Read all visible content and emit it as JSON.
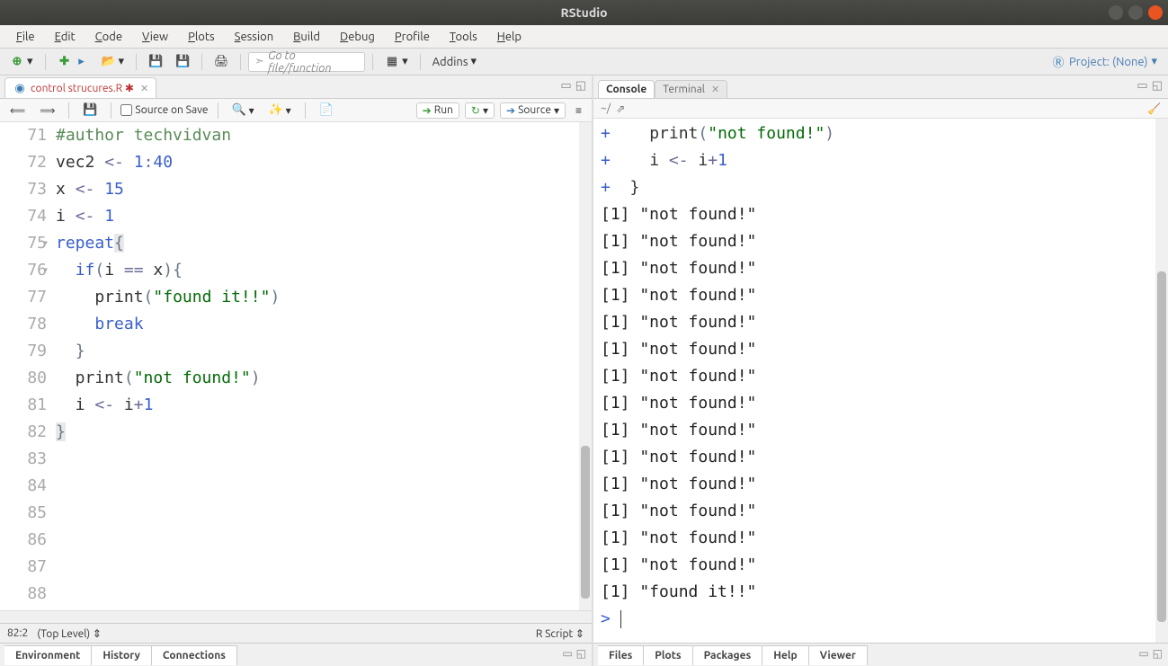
{
  "window": {
    "title": "RStudio"
  },
  "menus": [
    "File",
    "Edit",
    "Code",
    "View",
    "Plots",
    "Session",
    "Build",
    "Debug",
    "Profile",
    "Tools",
    "Help"
  ],
  "toolbar": {
    "goto_placeholder": "Go to file/function",
    "addins": "Addins",
    "project": "Project: (None)"
  },
  "source": {
    "tab_label": "control strucures.R",
    "save_on_source": "Source on Save",
    "run": "Run",
    "source_btn": "Source",
    "cursor_pos": "82:2",
    "scope": "(Top Level)",
    "lang": "R Script",
    "lines": [
      {
        "n": 71,
        "html": "<span class='tk-comment'>#author techvidvan</span>"
      },
      {
        "n": 72,
        "html": "vec2 <span class='tk-op'>&lt;-</span> <span class='tk-num'>1</span><span class='tk-op'>:</span><span class='tk-num'>40</span>"
      },
      {
        "n": 73,
        "html": "x <span class='tk-op'>&lt;-</span> <span class='tk-num'>15</span>"
      },
      {
        "n": 74,
        "html": "i <span class='tk-op'>&lt;-</span> <span class='tk-num'>1</span>"
      },
      {
        "n": 75,
        "fold": true,
        "html": "<span class='tk-kw'>repeat</span><span class='tk-paren' style='background:#e8e8e8'>{</span>"
      },
      {
        "n": 76,
        "fold": true,
        "html": "  <span class='tk-kw'>if</span><span class='tk-paren'>(</span>i <span class='tk-op'>==</span> x<span class='tk-paren'>){</span>"
      },
      {
        "n": 77,
        "html": "    print<span class='tk-paren'>(</span><span class='tk-str'>\"found it!!\"</span><span class='tk-paren'>)</span>"
      },
      {
        "n": 78,
        "html": "    <span class='tk-kw'>break</span>"
      },
      {
        "n": 79,
        "html": "  <span class='tk-paren'>}</span>"
      },
      {
        "n": 80,
        "html": "  print<span class='tk-paren'>(</span><span class='tk-str'>\"not found!\"</span><span class='tk-paren'>)</span>"
      },
      {
        "n": 81,
        "html": "  i <span class='tk-op'>&lt;-</span> i<span class='tk-op'>+</span><span class='tk-num'>1</span>"
      },
      {
        "n": 82,
        "html": "<span class='tk-paren' style='background:#e8e8e8'>}</span>"
      },
      {
        "n": 83,
        "html": ""
      },
      {
        "n": 84,
        "html": ""
      },
      {
        "n": 85,
        "html": ""
      },
      {
        "n": 86,
        "html": ""
      },
      {
        "n": 87,
        "html": ""
      },
      {
        "n": 88,
        "html": ""
      }
    ]
  },
  "console": {
    "tab_console": "Console",
    "tab_terminal": "Terminal",
    "path": "~/",
    "lines": [
      {
        "type": "cont",
        "html": "  print<span class='tk-paren'>(</span><span class='cons-str'>\"not found!\"</span><span class='tk-paren'>)</span>"
      },
      {
        "type": "cont",
        "html": "  i <span class='tk-op'>&lt;-</span> i<span class='tk-op'>+</span><span class='cons-num'>1</span>"
      },
      {
        "type": "cont",
        "html": "}"
      },
      {
        "type": "out",
        "text": "[1] \"not found!\""
      },
      {
        "type": "out",
        "text": "[1] \"not found!\""
      },
      {
        "type": "out",
        "text": "[1] \"not found!\""
      },
      {
        "type": "out",
        "text": "[1] \"not found!\""
      },
      {
        "type": "out",
        "text": "[1] \"not found!\""
      },
      {
        "type": "out",
        "text": "[1] \"not found!\""
      },
      {
        "type": "out",
        "text": "[1] \"not found!\""
      },
      {
        "type": "out",
        "text": "[1] \"not found!\""
      },
      {
        "type": "out",
        "text": "[1] \"not found!\""
      },
      {
        "type": "out",
        "text": "[1] \"not found!\""
      },
      {
        "type": "out",
        "text": "[1] \"not found!\""
      },
      {
        "type": "out",
        "text": "[1] \"not found!\""
      },
      {
        "type": "out",
        "text": "[1] \"not found!\""
      },
      {
        "type": "out",
        "text": "[1] \"not found!\""
      },
      {
        "type": "out",
        "text": "[1] \"found it!!\""
      },
      {
        "type": "prompt",
        "text": ""
      }
    ]
  },
  "bottom_left_tabs": [
    "Environment",
    "History",
    "Connections"
  ],
  "bottom_right_tabs": [
    "Files",
    "Plots",
    "Packages",
    "Help",
    "Viewer"
  ]
}
